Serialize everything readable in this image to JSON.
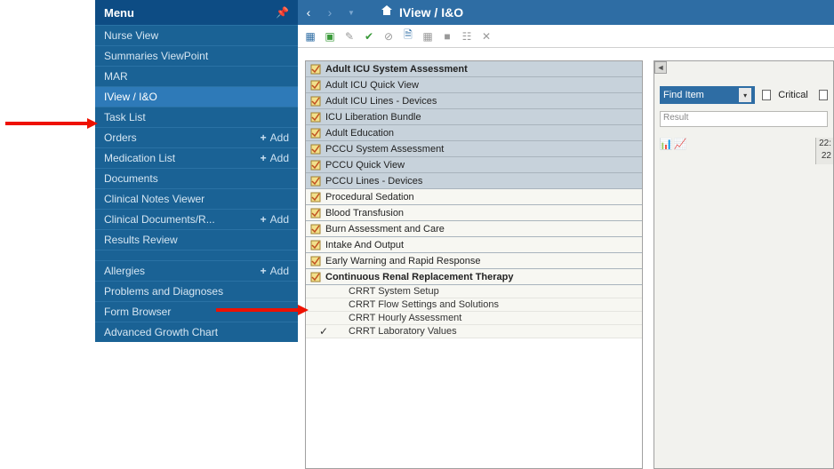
{
  "menu": {
    "title": "Menu",
    "items": [
      {
        "label": "Nurse View",
        "add": false
      },
      {
        "label": "Summaries ViewPoint",
        "add": false
      },
      {
        "label": "MAR",
        "add": false
      },
      {
        "label": "IView / I&O",
        "add": false,
        "selected": true
      },
      {
        "label": "Task List",
        "add": false
      },
      {
        "label": "Orders",
        "add": true
      },
      {
        "label": "Medication List",
        "add": true
      },
      {
        "label": "Documents",
        "add": false
      },
      {
        "label": "Clinical Notes Viewer",
        "add": false
      },
      {
        "label": "Clinical Documents/R...",
        "add": true
      },
      {
        "label": "Results Review",
        "add": false
      }
    ],
    "items2": [
      {
        "label": "Allergies",
        "add": true
      },
      {
        "label": "Problems and Diagnoses",
        "add": false
      },
      {
        "label": "Form Browser",
        "add": false
      },
      {
        "label": "Advanced Growth Chart",
        "add": false
      }
    ],
    "add_label": "Add"
  },
  "header": {
    "breadcrumb": "IView / I&O"
  },
  "bands": [
    {
      "label": "Adult ICU System Assessment",
      "bold": true,
      "shade": true
    },
    {
      "label": "Adult ICU Quick View",
      "bold": false,
      "shade": true
    },
    {
      "label": "Adult ICU Lines - Devices",
      "bold": false,
      "shade": true
    },
    {
      "label": "ICU Liberation Bundle",
      "bold": false,
      "shade": true
    },
    {
      "label": "Adult Education",
      "bold": false,
      "shade": true
    },
    {
      "label": "PCCU System Assessment",
      "bold": false,
      "shade": true
    },
    {
      "label": "PCCU Quick View",
      "bold": false,
      "shade": true
    },
    {
      "label": "PCCU Lines - Devices",
      "bold": false,
      "shade": true
    },
    {
      "label": "Procedural Sedation",
      "bold": false,
      "shade": false
    },
    {
      "label": "Blood Transfusion",
      "bold": false,
      "shade": false
    },
    {
      "label": "Burn Assessment and Care",
      "bold": false,
      "shade": false
    },
    {
      "label": "Intake And Output",
      "bold": false,
      "shade": false
    },
    {
      "label": "Early Warning and Rapid Response",
      "bold": false,
      "shade": false
    },
    {
      "label": "Continuous Renal Replacement Therapy",
      "bold": true,
      "shade": false
    }
  ],
  "sub_bands": [
    {
      "label": "CRRT System Setup",
      "checked": false
    },
    {
      "label": "CRRT Flow Settings and Solutions",
      "checked": false
    },
    {
      "label": "CRRT Hourly Assessment",
      "checked": false
    },
    {
      "label": "CRRT Laboratory Values",
      "checked": true
    }
  ],
  "right": {
    "find_label": "Find Item",
    "critical_label": "Critical",
    "result_label": "Result",
    "time_lines": [
      "22:",
      "22"
    ]
  }
}
